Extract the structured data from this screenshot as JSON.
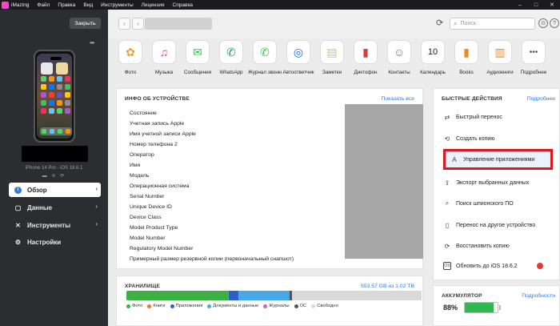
{
  "menubar": {
    "app_name": "iMazing",
    "items": [
      "Файл",
      "Правка",
      "Вид",
      "Инструменты",
      "Лицензия",
      "Справка"
    ],
    "controls": [
      "–",
      "□",
      "✕"
    ]
  },
  "sidebar": {
    "close_label": "Закрыть",
    "more_label": "•••",
    "device_model": "iPhone 14 Pro - iOS 18.6.1",
    "status_icons": "▬ ≋ ⟳",
    "nav": [
      {
        "label": "Обзор",
        "icon": "i",
        "active": true
      },
      {
        "label": "Данные",
        "icon": "▢",
        "active": false
      },
      {
        "label": "Инструменты",
        "icon": "✕",
        "active": false
      },
      {
        "label": "Настройки",
        "icon": "⚙",
        "active": false
      }
    ]
  },
  "toolbar": {
    "back": "‹",
    "forward": "›",
    "search_placeholder": "Поиск",
    "refresh": "⟳",
    "account": "⊙",
    "help": "?"
  },
  "apps": [
    {
      "label": "Фото",
      "glyph": "✿",
      "color": "#f0a030"
    },
    {
      "label": "Музыка",
      "glyph": "♫",
      "color": "#f43b6a"
    },
    {
      "label": "Сообщения",
      "glyph": "✉",
      "color": "#2ec94a"
    },
    {
      "label": "WhatsApp",
      "glyph": "✆",
      "color": "#25a244"
    },
    {
      "label": "Журнал звонков",
      "glyph": "✆",
      "color": "#2ec94a"
    },
    {
      "label": "Автоответчик",
      "glyph": "◎",
      "color": "#1e6fe0"
    },
    {
      "label": "Заметки",
      "glyph": "▤",
      "color": "#f2c230"
    },
    {
      "label": "Диктофон",
      "glyph": "▮",
      "color": "#e03b3b"
    },
    {
      "label": "Контакты",
      "glyph": "☺",
      "color": "#7a7a7a"
    },
    {
      "label": "Календарь",
      "glyph": "10",
      "color": "#222222"
    },
    {
      "label": "Books",
      "glyph": "▮",
      "color": "#f08a1c"
    },
    {
      "label": "Аудиокниги",
      "glyph": "▥",
      "color": "#f08a1c"
    },
    {
      "label": "Подробнее",
      "glyph": "•••",
      "color": "#555555"
    }
  ],
  "device_info": {
    "title": "ИНФО ОБ УСТРОЙСТВЕ",
    "show_all": "Показать все",
    "rows": [
      "Состояние",
      "Учетная запись Apple",
      "Имя учетной записи Apple",
      "Номер телефона 2",
      "Оператор",
      "Имя",
      "Модель",
      "Операционная система",
      "Serial Number",
      "Unique Device ID",
      "Device Class",
      "Model Product Type",
      "Model Number",
      "Regulatory Model Number",
      "Примерный размер резервной копии (первоначальный снапшот)"
    ]
  },
  "storage": {
    "title": "ХРАНИЛИЩЕ",
    "usage": "553.57 GB из 1.02 TB",
    "segments": [
      {
        "label": "Фото",
        "share": 0.345,
        "color": "#3cb043"
      },
      {
        "label": "Книги",
        "share": 0.003,
        "color": "#f0712c"
      },
      {
        "label": "Приложения",
        "share": 0.032,
        "color": "#2e5fc9"
      },
      {
        "label": "Документы и данные",
        "share": 0.17,
        "color": "#46a8e8"
      },
      {
        "label": "Журналы",
        "share": 0.004,
        "color": "#d25bd0"
      },
      {
        "label": "ОС",
        "share": 0.006,
        "color": "#555555"
      },
      {
        "label": "Свободно",
        "share": 0.44,
        "color": "#d9d9d9"
      }
    ]
  },
  "quick_actions": {
    "title": "БЫСТРЫЕ ДЕЙСТВИЯ",
    "more": "Подробнее",
    "items": [
      {
        "label": "Быстрый перенос",
        "icon": "⇄"
      },
      {
        "label": "Создать копию",
        "icon": "⟲"
      },
      {
        "label": "Управление приложениями",
        "icon": "Ａ",
        "highlight": true
      },
      {
        "label": "Экспорт выбранных данных",
        "icon": "⇪"
      },
      {
        "label": "Поиск шпионского ПО",
        "icon": "⌕"
      },
      {
        "label": "Перенос на другое устройство",
        "icon": "▯"
      },
      {
        "label": "Восстановить копию",
        "icon": "⟳"
      },
      {
        "label": "Обновить до iOS 18.6.2",
        "icon": "OS",
        "alert": true
      }
    ]
  },
  "battery": {
    "title": "АККУМУЛЯТОР",
    "more": "Подробности",
    "percent_label": "88%",
    "level": 0.88,
    "color": "#2fb84e"
  }
}
